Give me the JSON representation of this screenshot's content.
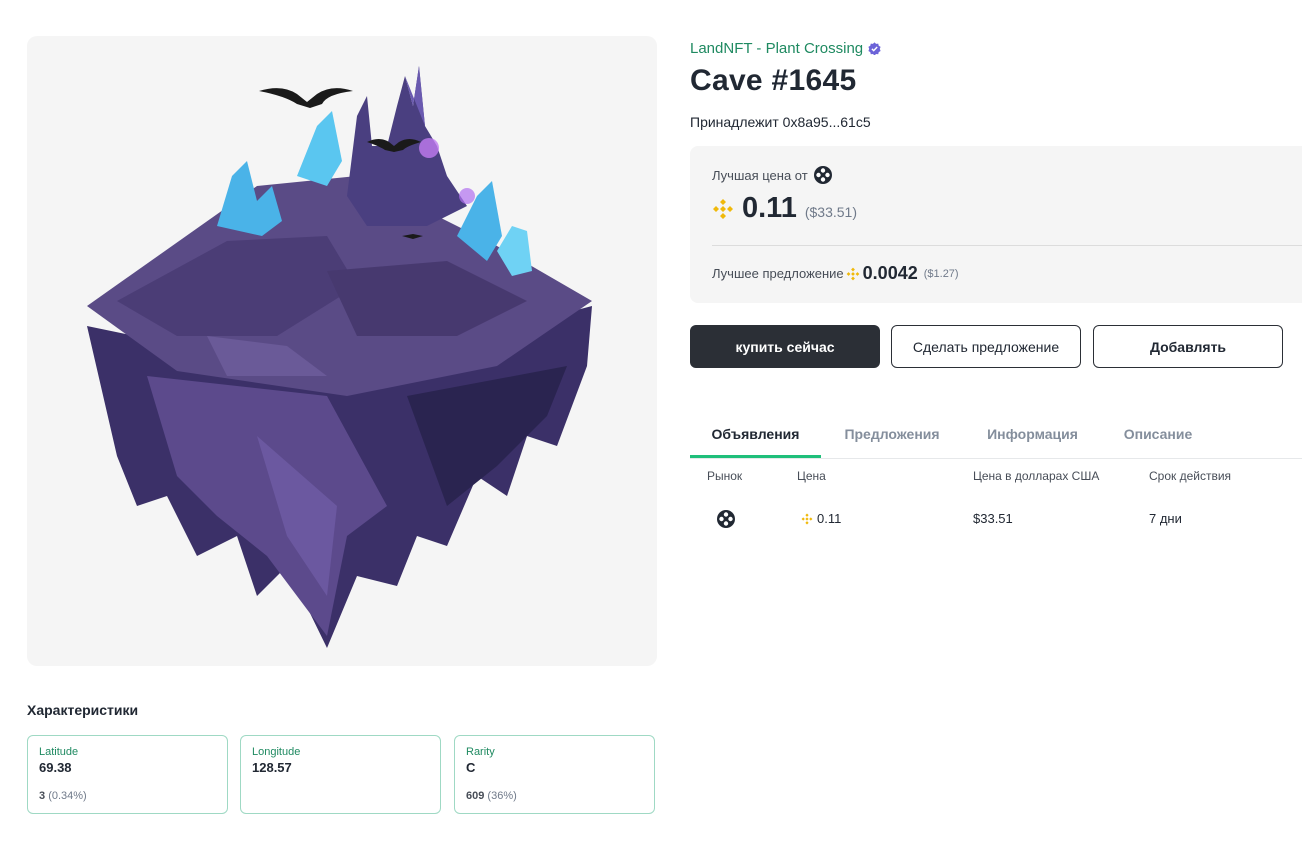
{
  "collection": {
    "name": "LandNFT - Plant Crossing",
    "verified_icon": "verified-badge-icon",
    "accent": "#1f8a61"
  },
  "nft": {
    "title": "Cave #1645",
    "owner_label": "Принадлежит",
    "owner_address": "0x8a95...61c5"
  },
  "price_box": {
    "best_price_label": "Лучшая цена от",
    "marketplace_icon": "marketplace-logo-icon",
    "currency_icon": "bnb-icon",
    "price": "0.11",
    "price_usd": "($33.51)",
    "best_offer_label": "Лучшее предложение",
    "offer_price": "0.0042",
    "offer_usd": "($1.27)"
  },
  "actions": {
    "buy": "купить сейчас",
    "offer": "Сделать предложение",
    "add": "Добавлять"
  },
  "tabs": [
    {
      "label": "Объявления",
      "active": true
    },
    {
      "label": "Предложения",
      "active": false
    },
    {
      "label": "Информация",
      "active": false
    },
    {
      "label": "Описание",
      "active": false
    }
  ],
  "listings": {
    "columns": [
      "Рынок",
      "Цена",
      "Цена в долларах США",
      "Срок действия"
    ],
    "rows": [
      {
        "market_icon": "marketplace-logo-icon",
        "price": "0.11",
        "price_usd": "$33.51",
        "expiry": "7 дни"
      }
    ]
  },
  "traits": {
    "title": "Характеристики",
    "items": [
      {
        "type": "Latitude",
        "value": "69.38",
        "count": "3",
        "percent": "(0.34%)"
      },
      {
        "type": "Longitude",
        "value": "128.57",
        "count": "",
        "percent": ""
      },
      {
        "type": "Rarity",
        "value": "C",
        "count": "609",
        "percent": "(36%)"
      }
    ]
  },
  "colors": {
    "buy_button": "#2b2f36",
    "tab_active_underline": "#1fbf7a",
    "bnb": "#f0b90b"
  }
}
